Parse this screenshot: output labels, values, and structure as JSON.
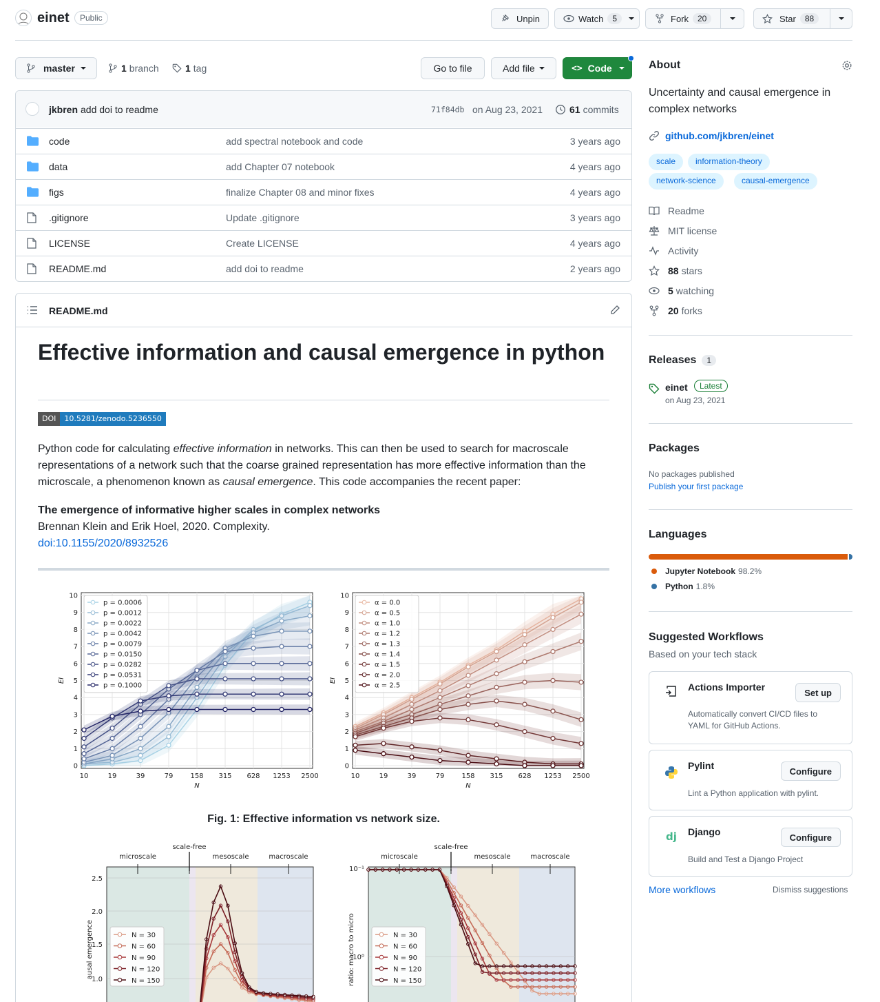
{
  "repo": {
    "name": "einet",
    "visibility": "Public"
  },
  "header": {
    "unpin": "Unpin",
    "watch": "Watch",
    "watch_count": "5",
    "fork": "Fork",
    "fork_count": "20",
    "star": "Star",
    "star_count": "88"
  },
  "toolbar": {
    "branch": "master",
    "branches_count": "1",
    "branches_label": "branch",
    "tags_count": "1",
    "tags_label": "tag",
    "goto": "Go to file",
    "addfile": "Add file",
    "code": "Code"
  },
  "commit": {
    "author": "jkbren",
    "message": "add doi to readme",
    "hash": "71f84db",
    "date": "on Aug 23, 2021",
    "count": "61",
    "count_label": "commits"
  },
  "files": [
    {
      "name": "code",
      "type": "dir",
      "msg": "add spectral notebook and code",
      "ago": "3 years ago"
    },
    {
      "name": "data",
      "type": "dir",
      "msg": "add Chapter 07 notebook",
      "ago": "4 years ago"
    },
    {
      "name": "figs",
      "type": "dir",
      "msg": "finalize Chapter 08 and minor fixes",
      "ago": "4 years ago"
    },
    {
      "name": ".gitignore",
      "type": "file",
      "msg": "Update .gitignore",
      "ago": "3 years ago"
    },
    {
      "name": "LICENSE",
      "type": "file",
      "msg": "Create LICENSE",
      "ago": "4 years ago"
    },
    {
      "name": "README.md",
      "type": "file",
      "msg": "add doi to readme",
      "ago": "2 years ago"
    }
  ],
  "readme": {
    "file": "README.md",
    "title": "Effective information and causal emergence in python",
    "doi_label": "DOI",
    "doi_value": "10.5281/zenodo.5236550",
    "p1a": "Python code for calculating ",
    "p1b": "effective information",
    "p1c": " in networks. This can then be used to search for macroscale representations of a network such that the coarse grained representation has more effective information than the microscale, a phenomenon known as ",
    "p1d": "causal emergence",
    "p1e": ". This code accompanies the recent paper:",
    "paper_title": "The emergence of informative higher scales in complex networks",
    "paper_authors": "Brennan Klein and Erik Hoel, 2020. Complexity.",
    "paper_doi": "doi:10.1155/2020/8932526",
    "fig1_caption": "Fig. 1: Effective information vs network size."
  },
  "sidebar": {
    "about": "About",
    "description": "Uncertainty and causal emergence in complex networks",
    "link": "github.com/jkbren/einet",
    "topics": [
      "scale",
      "information-theory",
      "network-science",
      "causal-emergence"
    ],
    "links": [
      {
        "icon": "book-icon",
        "pre": "",
        "label": "Readme"
      },
      {
        "icon": "law-icon",
        "pre": "",
        "label": "MIT license"
      },
      {
        "icon": "pulse-icon",
        "pre": "",
        "label": "Activity"
      },
      {
        "icon": "star-icon",
        "pre": "88",
        "label": "stars"
      },
      {
        "icon": "eye-icon",
        "pre": "5",
        "label": "watching"
      },
      {
        "icon": "fork-icon",
        "pre": "20",
        "label": "forks"
      }
    ],
    "releases": "Releases",
    "releases_count": "1",
    "release_name": "einet",
    "release_badge": "Latest",
    "release_date": "on Aug 23, 2021",
    "packages": "Packages",
    "no_packages": "No packages published",
    "publish": "Publish your first package",
    "languages": "Languages",
    "langs": [
      {
        "name": "Jupyter Notebook",
        "pct": "98.2%",
        "color": "#DA5B0B",
        "value": 98.2
      },
      {
        "name": "Python",
        "pct": "1.8%",
        "color": "#3572A5",
        "value": 1.8
      }
    ],
    "workflows_title": "Suggested Workflows",
    "workflows_sub": "Based on your tech stack",
    "workflows": [
      {
        "name": "Actions Importer",
        "desc": "Automatically convert CI/CD files to YAML for GitHub Actions.",
        "btn": "Set up"
      },
      {
        "name": "Pylint",
        "desc": "Lint a Python application with pylint.",
        "btn": "Configure"
      },
      {
        "name": "Django",
        "desc": "Build and Test a Django Project",
        "btn": "Configure"
      }
    ],
    "more_workflows": "More workflows",
    "dismiss": "Dismiss suggestions"
  },
  "chart_data": [
    {
      "type": "line",
      "xlabel": "N",
      "ylabel": "EI",
      "ylim": [
        0,
        10
      ],
      "x": [
        "10",
        "19",
        "39",
        "79",
        "158",
        "315",
        "628",
        "1253",
        "2500"
      ],
      "yticks": [
        "0",
        "1",
        "2",
        "3",
        "4",
        "5",
        "6",
        "7",
        "8",
        "9",
        "10"
      ],
      "legend": [
        "p = 0.0006",
        "p = 0.0012",
        "p = 0.0022",
        "p = 0.0042",
        "p = 0.0079",
        "p = 0.0150",
        "p = 0.0282",
        "p = 0.0531",
        "p = 0.1000"
      ],
      "series": [
        {
          "name": "p = 0.0006",
          "values": [
            0.0,
            0.1,
            0.3,
            1.2,
            3.3,
            5.9,
            7.9,
            8.9,
            9.6
          ]
        },
        {
          "name": "p = 0.0012",
          "values": [
            0.1,
            0.2,
            0.6,
            1.7,
            4.0,
            6.4,
            8.0,
            8.8,
            9.4
          ]
        },
        {
          "name": "p = 0.0022",
          "values": [
            0.1,
            0.4,
            1.0,
            2.3,
            4.6,
            6.7,
            7.8,
            8.5,
            8.8
          ]
        },
        {
          "name": "p = 0.0042",
          "values": [
            0.2,
            0.6,
            1.6,
            3.1,
            5.2,
            6.9,
            7.6,
            7.9,
            7.9
          ]
        },
        {
          "name": "p = 0.0079",
          "values": [
            0.4,
            1.0,
            2.3,
            3.9,
            5.6,
            6.7,
            6.9,
            7.0,
            7.0
          ]
        },
        {
          "name": "p = 0.0150",
          "values": [
            0.7,
            1.6,
            3.0,
            4.5,
            5.6,
            6.0,
            6.0,
            6.0,
            6.0
          ]
        },
        {
          "name": "p = 0.0282",
          "values": [
            1.1,
            2.2,
            3.6,
            4.7,
            5.1,
            5.1,
            5.1,
            5.1,
            5.1
          ]
        },
        {
          "name": "p = 0.0531",
          "values": [
            1.6,
            2.8,
            3.8,
            4.1,
            4.2,
            4.2,
            4.2,
            4.2,
            4.2
          ]
        },
        {
          "name": "p = 0.1000",
          "values": [
            2.1,
            2.9,
            3.2,
            3.3,
            3.3,
            3.3,
            3.3,
            3.3,
            3.3
          ]
        }
      ]
    },
    {
      "type": "line",
      "xlabel": "N",
      "ylabel": "EI",
      "ylim": [
        0,
        10
      ],
      "x": [
        "10",
        "19",
        "39",
        "79",
        "158",
        "315",
        "628",
        "1253",
        "2500"
      ],
      "yticks": [
        "0",
        "1",
        "2",
        "3",
        "4",
        "5",
        "6",
        "7",
        "8",
        "9",
        "10"
      ],
      "legend": [
        "α = 0.0",
        "α = 0.5",
        "α = 1.0",
        "α = 1.2",
        "α = 1.3",
        "α = 1.4",
        "α = 1.5",
        "α = 2.0",
        "α = 2.5"
      ],
      "series": [
        {
          "name": "α = 0.0",
          "values": [
            2.3,
            3.1,
            4.0,
            4.9,
            5.9,
            6.8,
            7.9,
            8.9,
            9.8
          ]
        },
        {
          "name": "α = 0.5",
          "values": [
            2.2,
            3.0,
            3.9,
            4.8,
            5.8,
            6.7,
            7.7,
            8.7,
            9.6
          ]
        },
        {
          "name": "α = 1.0",
          "values": [
            2.1,
            2.8,
            3.6,
            4.4,
            5.3,
            6.2,
            7.1,
            8.0,
            8.9
          ]
        },
        {
          "name": "α = 1.2",
          "values": [
            2.0,
            2.6,
            3.3,
            4.0,
            4.7,
            5.4,
            6.1,
            6.7,
            7.3
          ]
        },
        {
          "name": "α = 1.3",
          "values": [
            1.9,
            2.5,
            3.0,
            3.6,
            4.1,
            4.6,
            4.9,
            5.0,
            4.9
          ]
        },
        {
          "name": "α = 1.4",
          "values": [
            1.8,
            2.3,
            2.8,
            3.3,
            3.6,
            3.8,
            3.6,
            3.2,
            2.7
          ]
        },
        {
          "name": "α = 1.5",
          "values": [
            1.7,
            2.2,
            2.6,
            2.8,
            2.7,
            2.4,
            2.0,
            1.6,
            1.3
          ]
        },
        {
          "name": "α = 2.0",
          "values": [
            1.2,
            1.3,
            1.1,
            0.9,
            0.6,
            0.4,
            0.2,
            0.1,
            0.1
          ]
        },
        {
          "name": "α = 2.5",
          "values": [
            0.9,
            0.7,
            0.5,
            0.3,
            0.2,
            0.1,
            0.0,
            0.0,
            0.0
          ]
        }
      ]
    },
    {
      "type": "line",
      "ylabel": "ausal emergence",
      "yticks": [
        "1.0",
        "1.5",
        "2.0",
        "2.5"
      ],
      "regions": [
        "microscale",
        "scale-free",
        "mesoscale",
        "macroscale"
      ],
      "legend": [
        "N = 30",
        "N = 60",
        "N = 90",
        "N = 120",
        "N = 150"
      ]
    },
    {
      "type": "line",
      "ylabel": "ratio: macro to micro",
      "yticks": [
        "10⁰",
        "10⁻¹"
      ],
      "regions": [
        "microscale",
        "scale-free",
        "mesoscale",
        "macroscale"
      ],
      "legend": [
        "N = 30",
        "N = 60",
        "N = 90",
        "N = 120",
        "N = 150"
      ]
    }
  ]
}
